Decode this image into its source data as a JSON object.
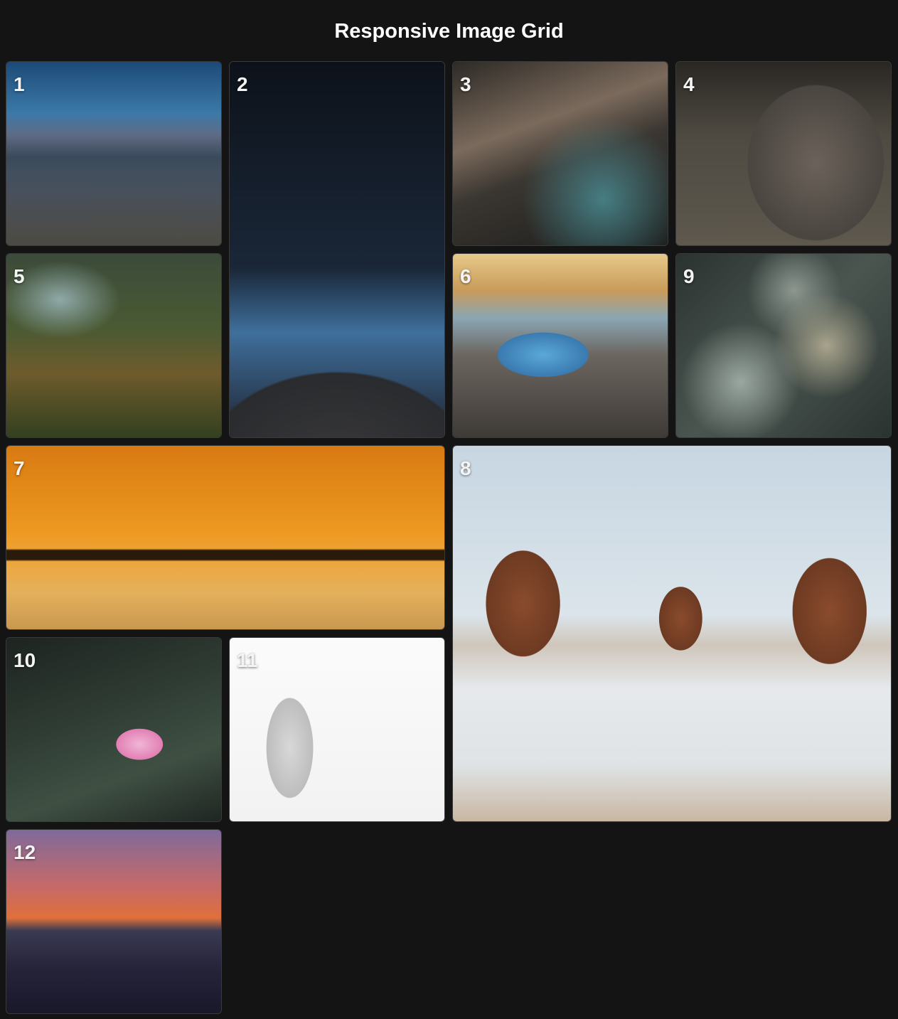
{
  "page": {
    "title": "Responsive Image Grid"
  },
  "tiles": [
    {
      "number": "1"
    },
    {
      "number": "2"
    },
    {
      "number": "3"
    },
    {
      "number": "4"
    },
    {
      "number": "5"
    },
    {
      "number": "6"
    },
    {
      "number": "7"
    },
    {
      "number": "8"
    },
    {
      "number": "9"
    },
    {
      "number": "10"
    },
    {
      "number": "11"
    },
    {
      "number": "12"
    }
  ],
  "colors": {
    "background": "#141414",
    "title_text": "#ffffff",
    "tile_border": "#3a3a3a"
  }
}
